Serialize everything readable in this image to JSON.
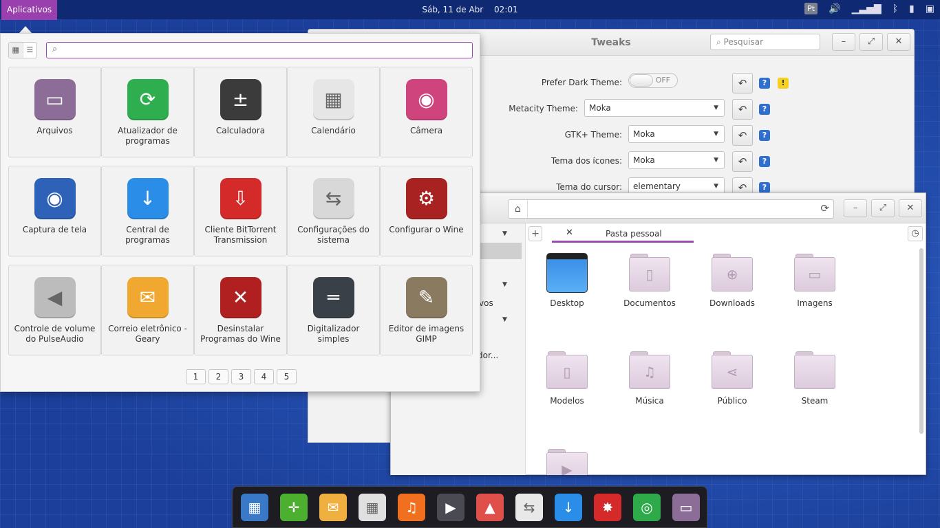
{
  "panel": {
    "apps_label": "Aplicativos",
    "date": "Sáb, 11 de Abr",
    "time": "02:01",
    "lang": "Pt"
  },
  "tweaks": {
    "title": "Tweaks",
    "search_placeholder": "Pesquisar",
    "rows": [
      {
        "label": "Prefer Dark Theme:",
        "value": "OFF"
      },
      {
        "label": "Metacity Theme:",
        "value": "Moka"
      },
      {
        "label": "GTK+ Theme:",
        "value": "Moka"
      },
      {
        "label": "Tema dos ícones:",
        "value": "Moka"
      },
      {
        "label": "Tema do cursor:",
        "value": "elementary"
      }
    ],
    "help_glyph": "?",
    "warn_glyph": "!"
  },
  "files": {
    "tab_label": "Pasta pessoal",
    "sidebar_fragments": [
      "vos",
      "dor..."
    ],
    "folders": [
      "Desktop",
      "Documentos",
      "Downloads",
      "Imagens",
      "Modelos",
      "Música",
      "Público",
      "Steam"
    ]
  },
  "appmenu": {
    "apps": [
      {
        "label": "Arquivos",
        "color": "#8c6d98",
        "glyph": "▭"
      },
      {
        "label": "Atualizador de programas",
        "color": "#2fae4f",
        "glyph": "⟳"
      },
      {
        "label": "Calculadora",
        "color": "#3b3b3b",
        "glyph": "±"
      },
      {
        "label": "Calendário",
        "color": "#e6e6e6",
        "glyph": "▦"
      },
      {
        "label": "Câmera",
        "color": "#d0447e",
        "glyph": "◉"
      },
      {
        "label": "Captura de tela",
        "color": "#2d62b8",
        "glyph": "◉"
      },
      {
        "label": "Central de programas",
        "color": "#2a8ee8",
        "glyph": "↓"
      },
      {
        "label": "Cliente BitTorrent Transmission",
        "color": "#d42a2a",
        "glyph": "⇩"
      },
      {
        "label": "Configurações do sistema",
        "color": "#d8d8d8",
        "glyph": "⇆"
      },
      {
        "label": "Configurar o Wine",
        "color": "#a82222",
        "glyph": "⚙"
      },
      {
        "label": "Controle de volume do PulseAudio",
        "color": "#bcbcbc",
        "glyph": "◀"
      },
      {
        "label": "Correio eletrônico - Geary",
        "color": "#f0a830",
        "glyph": "✉"
      },
      {
        "label": "Desinstalar Programas do Wine",
        "color": "#b02020",
        "glyph": "✕"
      },
      {
        "label": "Digitalizador simples",
        "color": "#3a4048",
        "glyph": "═"
      },
      {
        "label": "Editor de imagens GIMP",
        "color": "#8a7a60",
        "glyph": "✎"
      }
    ],
    "pages": [
      "1",
      "2",
      "3",
      "4",
      "5"
    ]
  },
  "dock": {
    "items": [
      {
        "name": "multitasking-icon",
        "color": "#3a78c8",
        "glyph": "▦"
      },
      {
        "name": "browser-icon",
        "color": "#4caf30",
        "glyph": "✛"
      },
      {
        "name": "mail-icon",
        "color": "#f0b040",
        "glyph": "✉"
      },
      {
        "name": "calendar-icon",
        "color": "#e0e0e0",
        "glyph": "▦"
      },
      {
        "name": "music-icon",
        "color": "#f07020",
        "glyph": "♫"
      },
      {
        "name": "videos-icon",
        "color": "#4a4a52",
        "glyph": "▶"
      },
      {
        "name": "photos-icon",
        "color": "#e0504a",
        "glyph": "▲"
      },
      {
        "name": "settings-icon",
        "color": "#e8e8e8",
        "glyph": "⇆"
      },
      {
        "name": "software-center-icon",
        "color": "#2a8ee8",
        "glyph": "↓"
      },
      {
        "name": "transmission-icon",
        "color": "#d42a2a",
        "glyph": "✸"
      },
      {
        "name": "chrome-icon",
        "color": "#2eaa4a",
        "glyph": "◎"
      },
      {
        "name": "files-icon",
        "color": "#8c6d98",
        "glyph": "▭"
      }
    ]
  }
}
